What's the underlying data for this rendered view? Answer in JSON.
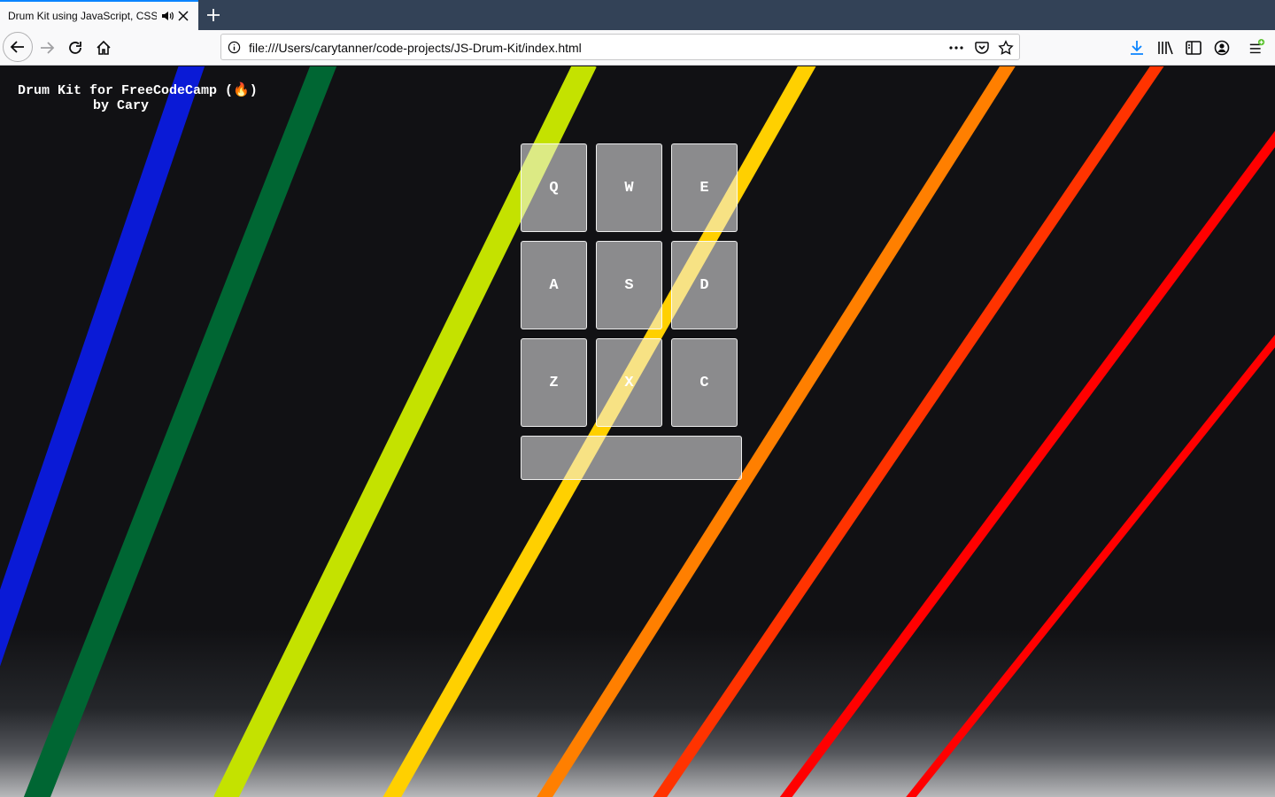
{
  "browser": {
    "tab_title": "Drum Kit using JavaScript, CSS",
    "url": "file:///Users/carytanner/code-projects/JS-Drum-Kit/index.html"
  },
  "page": {
    "title_line1": "Drum Kit for FreeCodeCamp (🔥)",
    "title_line2": "by Cary",
    "pads": [
      {
        "key": "Q"
      },
      {
        "key": "W"
      },
      {
        "key": "E"
      },
      {
        "key": "A"
      },
      {
        "key": "S"
      },
      {
        "key": "D"
      },
      {
        "key": "Z"
      },
      {
        "key": "X"
      },
      {
        "key": "C"
      }
    ],
    "display_text": "",
    "stripe_colors": [
      "#0a1ad6",
      "#006633",
      "#c4e200",
      "#ffd000",
      "#ff7f00",
      "#ff3300",
      "#ff0000",
      "#ff0000"
    ]
  }
}
